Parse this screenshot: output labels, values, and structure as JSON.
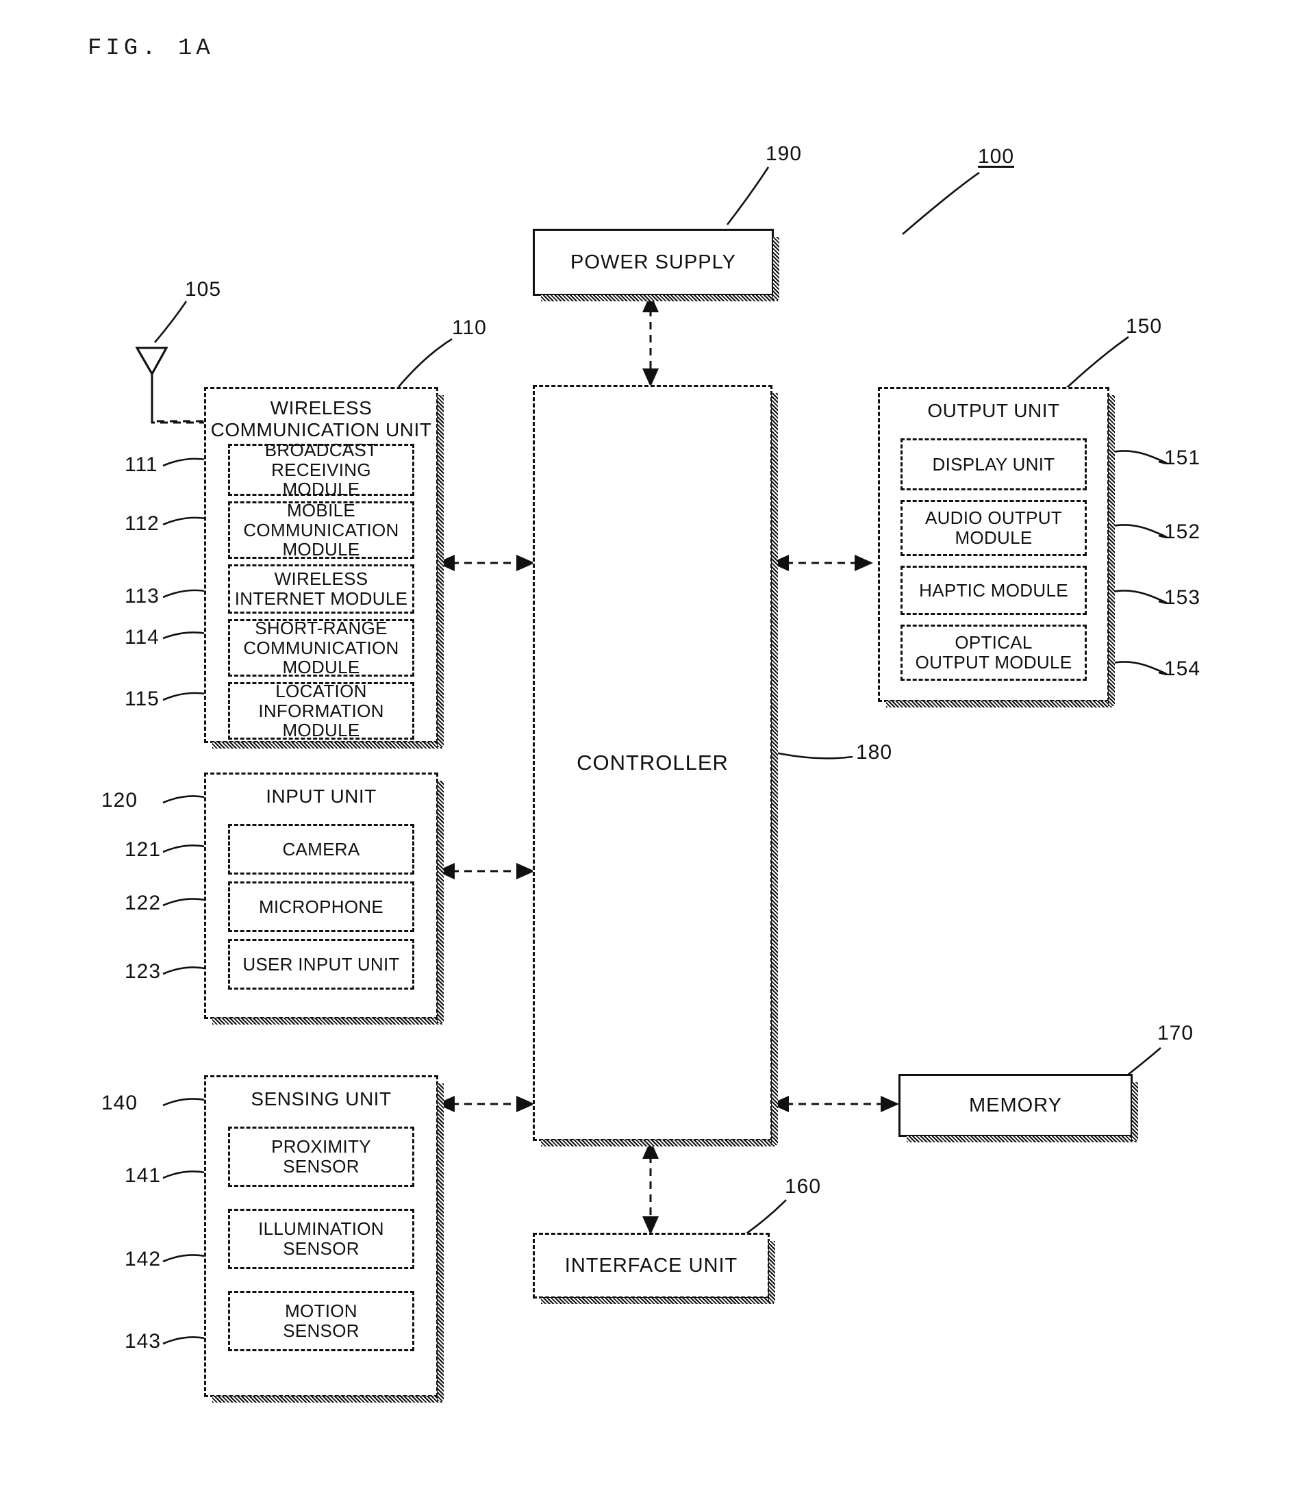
{
  "figure": {
    "title": "FIG. 1A",
    "device_ref": "100"
  },
  "blocks": {
    "power_supply": {
      "label": "POWER SUPPLY",
      "ref": "190"
    },
    "controller": {
      "label": "CONTROLLER",
      "ref": "180"
    },
    "memory": {
      "label": "MEMORY",
      "ref": "170"
    },
    "interface_unit": {
      "label": "INTERFACE UNIT",
      "ref": "160"
    },
    "antenna": {
      "ref": "105"
    }
  },
  "wireless_unit": {
    "title_line1": "WIRELESS",
    "title_line2": "COMMUNICATION UNIT",
    "ref": "110",
    "modules": [
      {
        "label": "BROADCAST\nRECEIVING MODULE",
        "ref": "111"
      },
      {
        "label": "MOBILE\nCOMMUNICATION\nMODULE",
        "ref": "112"
      },
      {
        "label": "WIRELESS\nINTERNET MODULE",
        "ref": "113"
      },
      {
        "label": "SHORT-RANGE\nCOMMUNICATION\nMODULE",
        "ref": "114"
      },
      {
        "label": "LOCATION\nINFORMATION\nMODULE",
        "ref": "115"
      }
    ]
  },
  "input_unit": {
    "title": "INPUT UNIT",
    "ref": "120",
    "modules": [
      {
        "label": "CAMERA",
        "ref": "121"
      },
      {
        "label": "MICROPHONE",
        "ref": "122"
      },
      {
        "label": "USER INPUT UNIT",
        "ref": "123"
      }
    ]
  },
  "sensing_unit": {
    "title": "SENSING UNIT",
    "ref": "140",
    "modules": [
      {
        "label": "PROXIMITY\nSENSOR",
        "ref": "141"
      },
      {
        "label": "ILLUMINATION\nSENSOR",
        "ref": "142"
      },
      {
        "label": "MOTION\nSENSOR",
        "ref": "143"
      }
    ]
  },
  "output_unit": {
    "title": "OUTPUT UNIT",
    "ref": "150",
    "modules": [
      {
        "label": "DISPLAY UNIT",
        "ref": "151"
      },
      {
        "label": "AUDIO OUTPUT\nMODULE",
        "ref": "152"
      },
      {
        "label": "HAPTIC MODULE",
        "ref": "153"
      },
      {
        "label": "OPTICAL\nOUTPUT MODULE",
        "ref": "154"
      }
    ]
  },
  "colors": {
    "ink": "#111111",
    "paper": "#ffffff"
  }
}
